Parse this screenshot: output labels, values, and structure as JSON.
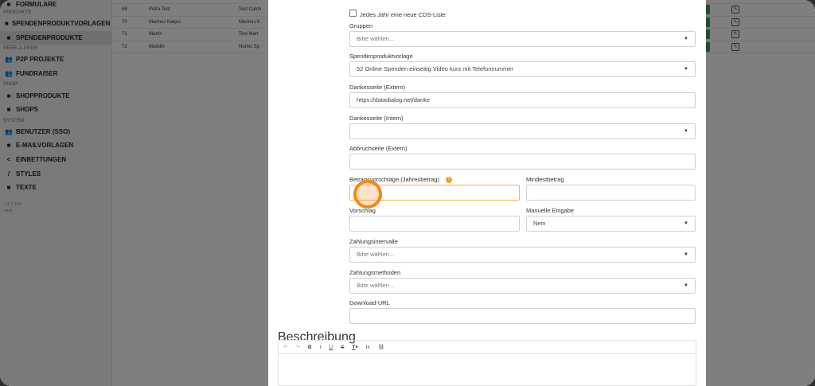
{
  "sidebar": {
    "top_item": "FORMULARE",
    "sec_produkte": "PRODUKTE",
    "item_spendenproduktvorlagen": "SPENDENPRODUKTVORLAGEN",
    "item_spendenprodukte": "SPENDENPRODUKTE",
    "sec_p2p": "PEER-2-PEER",
    "item_p2p": "P2P PROJEKTE",
    "item_fundraiser": "FUNDRAISER",
    "sec_shop": "SHOP",
    "item_shopprodukte": "SHOPPRODUKTE",
    "item_shops": "SHOPS",
    "sec_system": "SYSTEM",
    "item_benutzer": "BENUTZER (SSO)",
    "item_emailvorlagen": "E-MAILVORLAGEN",
    "item_einbettungen": "EINBETTUNGEN",
    "item_styles": "STYLES",
    "item_texte": "TEXTE",
    "version": "v1.3.165",
    "version2": "test"
  },
  "table": {
    "rows": [
      {
        "id": "68",
        "name": "Petra Test",
        "col2": "Test Catch"
      },
      {
        "id": "70",
        "name": "Marinus Kaqus",
        "col2": "Marinus K"
      },
      {
        "id": "71",
        "name": "Martin",
        "col2": "Test Mart"
      },
      {
        "id": "72",
        "name": "Maddin",
        "col2": "Nomis Sp"
      }
    ]
  },
  "form": {
    "checkbox_label": "Jedes Jahr eine neue CDS-Liste",
    "gruppen_label": "Gruppen",
    "gruppen_value": "Bitte wählen...",
    "vorlage_label": "Spendenproduktvorlage",
    "vorlage_value": "52 Online Spenden einseitig Video kurz mit Telefonnummer",
    "dankesseite_extern_label": "Dankesseite (Extern)",
    "dankesseite_extern_value": "https://datadialog.net/danke",
    "dankesseite_intern_label": "Dankesseite (Intern)",
    "abbruchseite_label": "Abbruchseite (Extern)",
    "betrag_label": "Betragsvorschläge (Jahresbetrag)",
    "mindest_label": "Mindestbetrag",
    "vorschlag_label": "Vorschlag",
    "manuelle_label": "Manuelle Eingabe",
    "manuelle_value": "Nein",
    "intervalle_label": "Zahlungsintervalle",
    "intervalle_value": "Bitte wählen...",
    "methoden_label": "Zahlungsmethoden",
    "methoden_value": "Bitte wählen...",
    "download_label": "Download-URL",
    "beschreibung_label": "Beschreibung",
    "caret": "▼",
    "info": "!"
  },
  "toolbar": {
    "undo": "↶",
    "redo": "↷",
    "bold": "B",
    "italic": "I",
    "underline": "U",
    "strike": "S",
    "textcolor": "T",
    "textcolor_caret": "▾",
    "clear": "Ix",
    "link": "⛓"
  },
  "icons": {
    "file": "■",
    "users": "👥",
    "share": "<",
    "brush": "/",
    "edit": "✎"
  }
}
